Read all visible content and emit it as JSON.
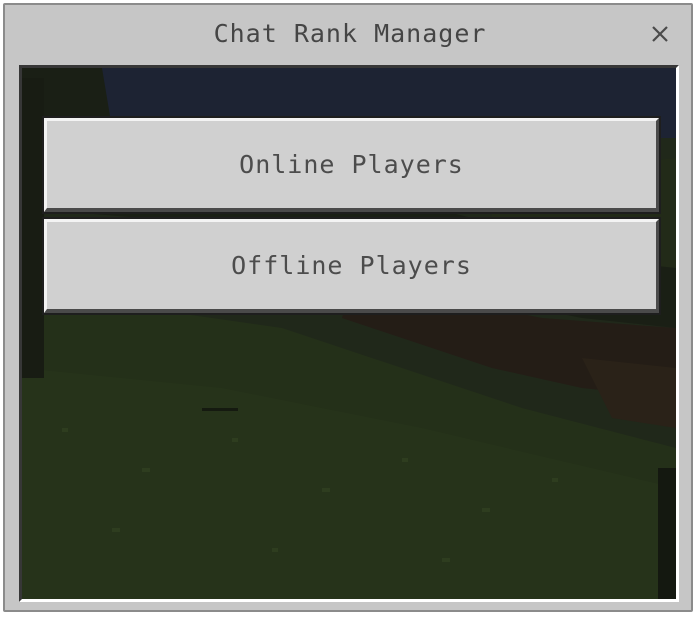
{
  "window": {
    "title": "Chat Rank Manager",
    "close_icon": "close-icon"
  },
  "menu": {
    "buttons": [
      {
        "label": "Online Players"
      },
      {
        "label": "Offline Players"
      }
    ]
  },
  "colors": {
    "panel": "#c6c6c6",
    "button_face": "#d0d0d0",
    "text": "#454545",
    "scene_grass": "#1f2a14",
    "scene_sky": "#1e2434"
  }
}
